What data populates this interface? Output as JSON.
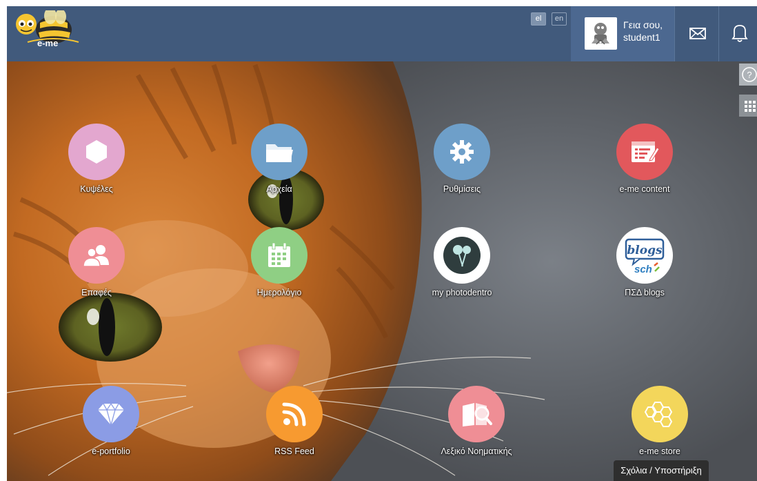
{
  "app": {
    "logo_text": "e-me"
  },
  "header": {
    "languages": [
      "el",
      "en"
    ],
    "active_language": "el",
    "greeting": "Γεια σου,",
    "username": "student1"
  },
  "tiles": [
    {
      "label": "Κυψέλες",
      "color": "#e3a7cf",
      "icon": "hexagon-icon"
    },
    {
      "label": "Αρχεία",
      "color": "#6e9fc9",
      "icon": "folder-icon"
    },
    {
      "label": "Ρυθμίσεις",
      "color": "#6e9fc9",
      "icon": "gear-icon"
    },
    {
      "label": "e-me content",
      "color": "#e2585c",
      "icon": "content-editor-icon"
    },
    {
      "label": "Επαφές",
      "color": "#ef8e95",
      "icon": "contacts-icon"
    },
    {
      "label": "Ημερολόγιο",
      "color": "#8fcf84",
      "icon": "calendar-icon"
    },
    {
      "label": "my photodentro",
      "color": "#ffffff",
      "icon": "photodentro-icon"
    },
    {
      "label": "ΠΣΔ blogs",
      "color": "#ffffff",
      "icon": "blogs-icon"
    },
    {
      "label": "e-portfolio",
      "color": "#8b9ce5",
      "icon": "diamond-icon"
    },
    {
      "label": "RSS Feed",
      "color": "#f79a30",
      "icon": "rss-icon"
    },
    {
      "label": "Λεξικό Νοηματικής",
      "color": "#ef8e95",
      "icon": "dictionary-icon"
    },
    {
      "label": "e-me store",
      "color": "#f3d65b",
      "icon": "honeycomb-icon"
    }
  ],
  "footer": {
    "feedback_label": "Σχόλια / Υποστήριξη"
  },
  "colors": {
    "topbar": "#415a7c",
    "user_box": "#4c6890"
  }
}
